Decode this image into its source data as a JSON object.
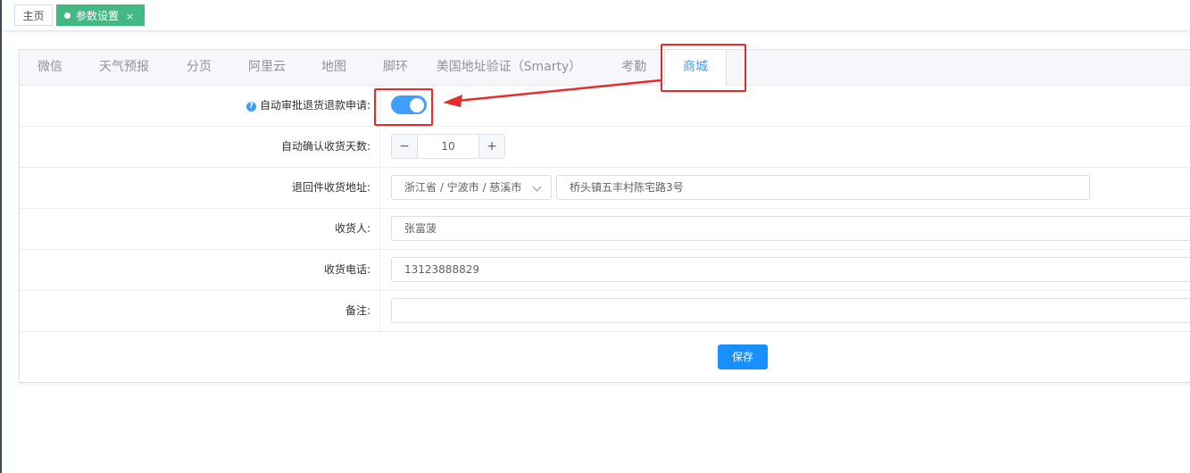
{
  "tags": {
    "home": "主页",
    "active": "参数设置",
    "close": "×"
  },
  "tabs": [
    {
      "label": "微信"
    },
    {
      "label": "天气预报"
    },
    {
      "label": "分页"
    },
    {
      "label": "阿里云"
    },
    {
      "label": "地图"
    },
    {
      "label": "脚环"
    },
    {
      "label": "美国地址验证（Smarty）"
    },
    {
      "label": "考勤"
    },
    {
      "label": "商城"
    }
  ],
  "active_tab": "商城",
  "form": {
    "auto_refund": {
      "label": "自动审批退货退款申请:",
      "enabled": true
    },
    "auto_confirm_days": {
      "label": "自动确认收货天数:",
      "value": "10",
      "minus": "−",
      "plus": "+"
    },
    "return_address": {
      "label": "退回件收货地址:",
      "region": "浙江省 / 宁波市 / 慈溪市",
      "detail": "桥头镇五丰村陈宅路3号"
    },
    "receiver": {
      "label": "收货人:",
      "value": "张富菠"
    },
    "phone": {
      "label": "收货电话:",
      "value": "13123888829"
    },
    "remark": {
      "label": "备注:",
      "value": ""
    }
  },
  "save_label": "保存",
  "colors": {
    "accent": "#409eff",
    "tag_active": "#42b983",
    "annotation": "#e62d2d"
  }
}
